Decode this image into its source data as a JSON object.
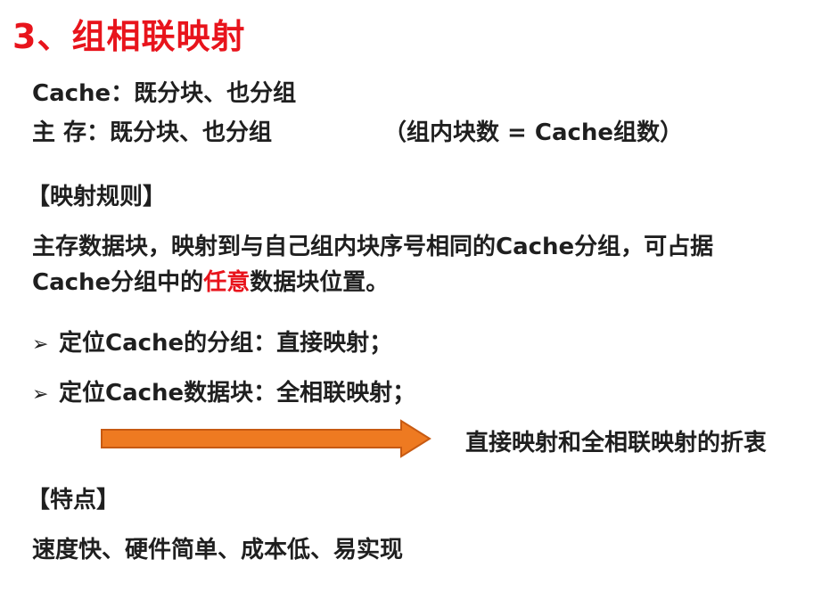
{
  "title": "3、组相联映射",
  "cache_line": "Cache：既分块、也分组",
  "memory_line": "主  存：既分块、也分组",
  "memory_note": "（组内块数 = Cache组数）",
  "rules_heading": "【映射规则】",
  "rules_text_line1": "主存数据块，映射到与自己组内块序号相同的Cache分组，可占据",
  "rules_text_line2_prefix": "Cache分组中的",
  "rules_text_line2_highlight": "任意",
  "rules_text_line2_suffix": "数据块位置。",
  "bullets": [
    {
      "marker": "➢",
      "text": "定位Cache的分组：直接映射；"
    },
    {
      "marker": "➢",
      "text": "定位Cache数据块：全相联映射；"
    }
  ],
  "arrow_label": "直接映射和全相联映射的折衷",
  "features_heading": "【特点】",
  "features_text": "速度快、硬件简单、成本低、易实现",
  "colors": {
    "title": "#e8141c",
    "highlight": "#e8141c",
    "arrow_fill": "#ee7a21",
    "arrow_stroke": "#c75a12"
  }
}
